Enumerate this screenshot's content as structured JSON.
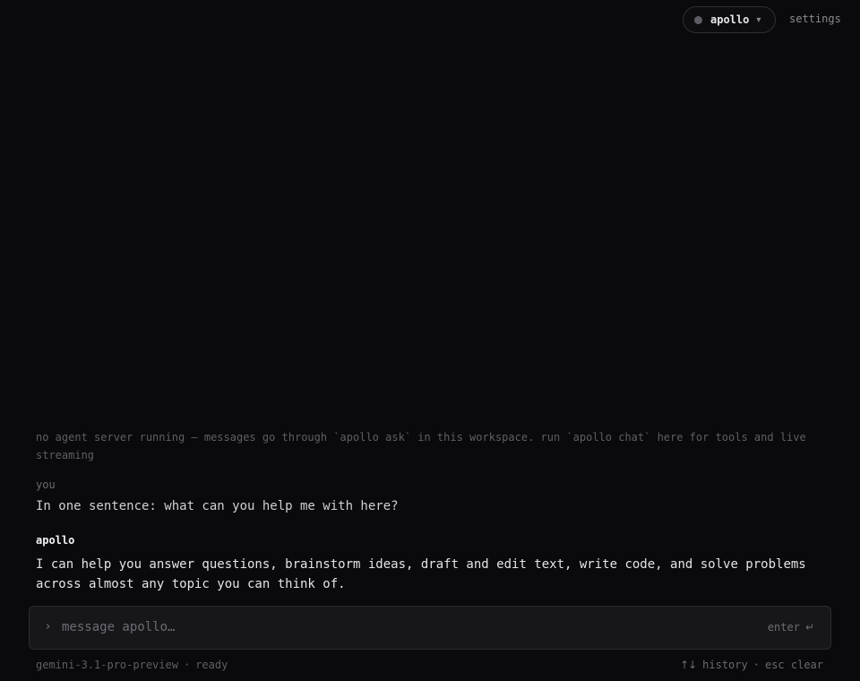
{
  "header": {
    "agent_name": "apollo",
    "chevron": "▾",
    "settings_label": "settings"
  },
  "conversation": {
    "notice": "no agent server running — messages go through `apollo ask` in this workspace. run `apollo chat` here for tools and live streaming",
    "messages": [
      {
        "speaker": "you",
        "text": "In one sentence: what can you help me with here?"
      },
      {
        "speaker": "apollo",
        "text": "I can help you answer questions, brainstorm ideas, draft and edit text, write code, and solve problems across almost any topic you can think of."
      }
    ]
  },
  "composer": {
    "prompt_glyph": "›",
    "value": "",
    "placeholder": "message apollo…",
    "enter_label": "enter",
    "enter_glyph": "↵"
  },
  "footer": {
    "model": "gemini-3.1-pro-preview",
    "separator": "·",
    "status": "ready",
    "history_glyph": "↑↓",
    "history_label": "history",
    "clear_label": "esc clear"
  },
  "colors": {
    "background": "#0a0a0c",
    "composer_bg": "#17171a",
    "status_dot": "#5c5c64",
    "muted_text": "#5e5e66"
  }
}
